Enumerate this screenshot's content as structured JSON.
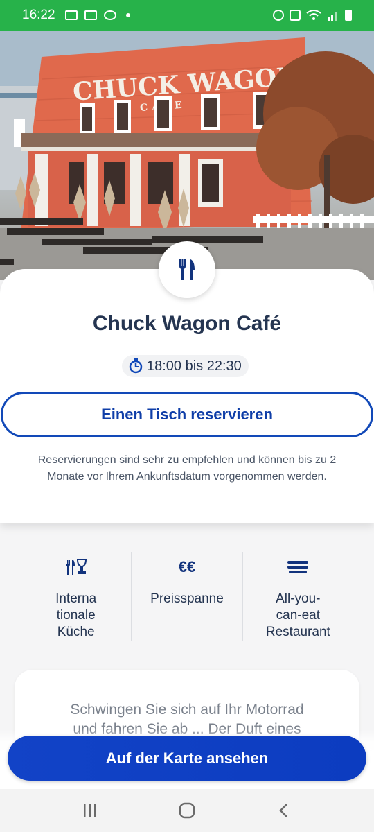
{
  "status_bar": {
    "time": "16:22",
    "left_icons": [
      "mail-icon",
      "image-icon",
      "chat-icon",
      "dot-icon"
    ],
    "right_icons": [
      "alarm-icon",
      "mute-icon",
      "wifi-icon",
      "signal-icon",
      "battery-icon"
    ]
  },
  "hero": {
    "sign_top": "CHUCK WAGON",
    "sign_bottom": "CAFE"
  },
  "restaurant": {
    "title": "Chuck Wagon Café",
    "hours": "18:00 bis 22:30",
    "reserve_label": "Einen Tisch reservieren",
    "note": "Reservierungen sind sehr zu empfehlen und können bis zu 2 Monate vor Ihrem Ankunftsdatum vorgenommen werden."
  },
  "features": [
    {
      "icon": "cutlery-wine-icon",
      "label_lines": [
        "Interna",
        "tionale",
        "Küche"
      ]
    },
    {
      "icon": "euro-icon",
      "icon_text": "€€",
      "label_lines": [
        "Preisspanne"
      ]
    },
    {
      "icon": "plates-icon",
      "label_lines": [
        "All-you-",
        "can-eat",
        "Restaurant"
      ]
    }
  ],
  "description": {
    "line1": "Schwingen Sie sich auf Ihr Motorrad",
    "line2": "und fahren Sie ab ... Der Duft eines"
  },
  "map_button": {
    "label": "Auf der Karte ansehen"
  },
  "nav": [
    "recents-icon",
    "home-icon",
    "back-icon"
  ],
  "colors": {
    "status_bar": "#27b24a",
    "primary_blue": "#1249b8",
    "title_navy": "#253551"
  }
}
